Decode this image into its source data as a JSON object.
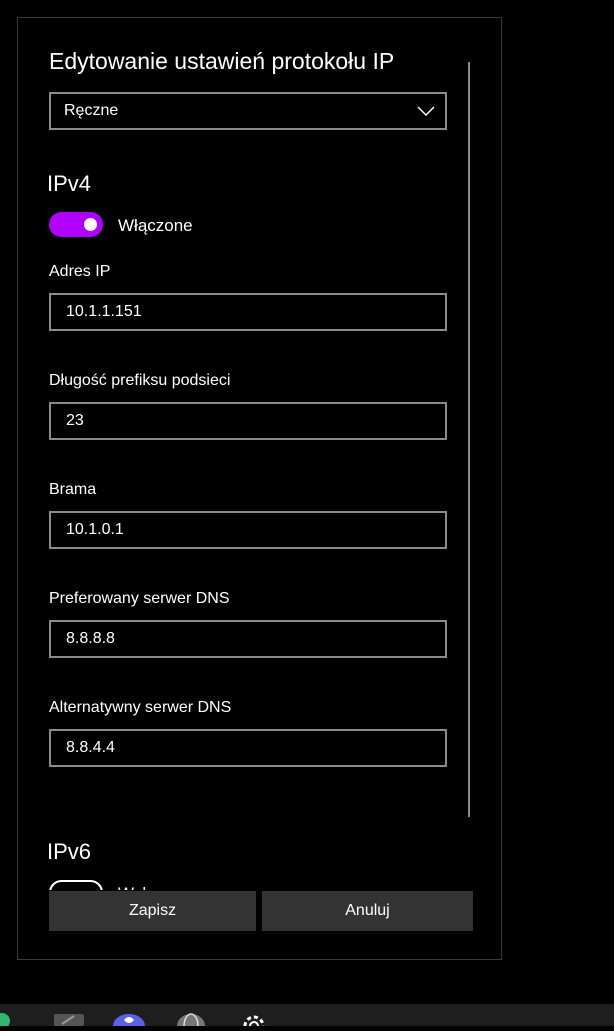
{
  "dialog": {
    "title": "Edytowanie ustawień protokołu IP",
    "mode_select": {
      "value": "Ręczne",
      "icon": "chevron-down-icon"
    }
  },
  "ipv4": {
    "heading": "IPv4",
    "toggle_label": "Włączone",
    "toggle_on": true,
    "accent_color": "#b000ff",
    "fields": {
      "ip_label": "Adres IP",
      "ip_value": "10.1.1.151",
      "prefix_label": "Długość prefiksu podsieci",
      "prefix_value": "23",
      "gateway_label": "Brama",
      "gateway_value": "10.1.0.1",
      "dns_pref_label": "Preferowany serwer DNS",
      "dns_pref_value": "8.8.8.8",
      "dns_alt_label": "Alternatywny serwer DNS",
      "dns_alt_value": "8.8.4.4"
    }
  },
  "ipv6": {
    "heading": "IPv6",
    "toggle_label": "Wyłączone",
    "toggle_on": false
  },
  "buttons": {
    "save_label": "Zapisz",
    "cancel_label": "Anuluj"
  },
  "taskbar": {
    "icons": [
      "app-icon",
      "store-icon",
      "heart-app-icon",
      "globe-icon",
      "settings-gear-icon"
    ]
  }
}
